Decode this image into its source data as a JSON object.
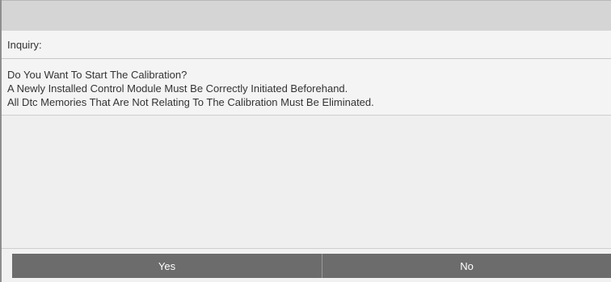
{
  "dialog": {
    "header_label": "Inquiry:",
    "message_lines": [
      "Do You Want To Start The Calibration?",
      "A Newly Installed Control Module Must Be Correctly Initiated Beforehand.",
      "All Dtc Memories That Are Not Relating To The Calibration Must Be Eliminated."
    ],
    "buttons": {
      "yes_label": "Yes",
      "no_label": "No"
    }
  },
  "colors": {
    "top_bar": "#d5d5d5",
    "button_bg": "#6c6c6c",
    "button_text": "#ffffff",
    "panel_bg": "#f4f4f4"
  }
}
